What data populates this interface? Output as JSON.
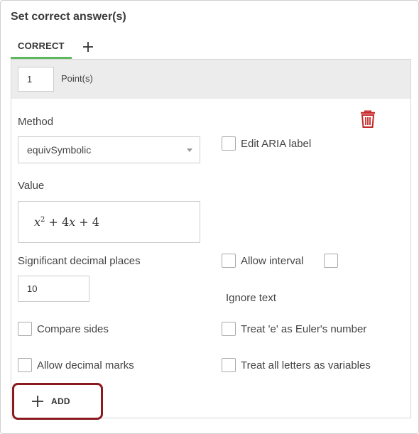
{
  "heading": "Set correct answer(s)",
  "tabs": [
    {
      "label": "CORRECT",
      "active": true
    }
  ],
  "points": {
    "value": "1",
    "label": "Point(s)"
  },
  "method": {
    "label": "Method",
    "selected": "equivSymbolic"
  },
  "aria": {
    "label": "Edit ARIA label",
    "checked": false
  },
  "value": {
    "label": "Value",
    "expression": "x^2 + 4x + 4"
  },
  "significant": {
    "label": "Significant decimal places",
    "value": "10"
  },
  "allow_interval": {
    "label": "Allow interval",
    "checked": false
  },
  "ignore_text": {
    "label": "Ignore text",
    "checked": false
  },
  "compare_sides": {
    "label": "Compare sides",
    "checked": false
  },
  "euler": {
    "label": "Treat 'e' as Euler's number",
    "checked": false
  },
  "decimal_marks": {
    "label": "Allow decimal marks",
    "checked": false
  },
  "letters_variables": {
    "label": "Treat all letters as variables",
    "checked": false
  },
  "add_button": {
    "label": "ADD"
  },
  "colors": {
    "tab_underline": "#5eb95e",
    "trash": "#c62828",
    "highlight": "#8b1a1f",
    "points_bar": "#ececec"
  },
  "icons": {
    "add_tab": "plus-icon",
    "delete": "trash-icon",
    "add": "plus-icon",
    "dropdown": "caret-down-icon"
  }
}
